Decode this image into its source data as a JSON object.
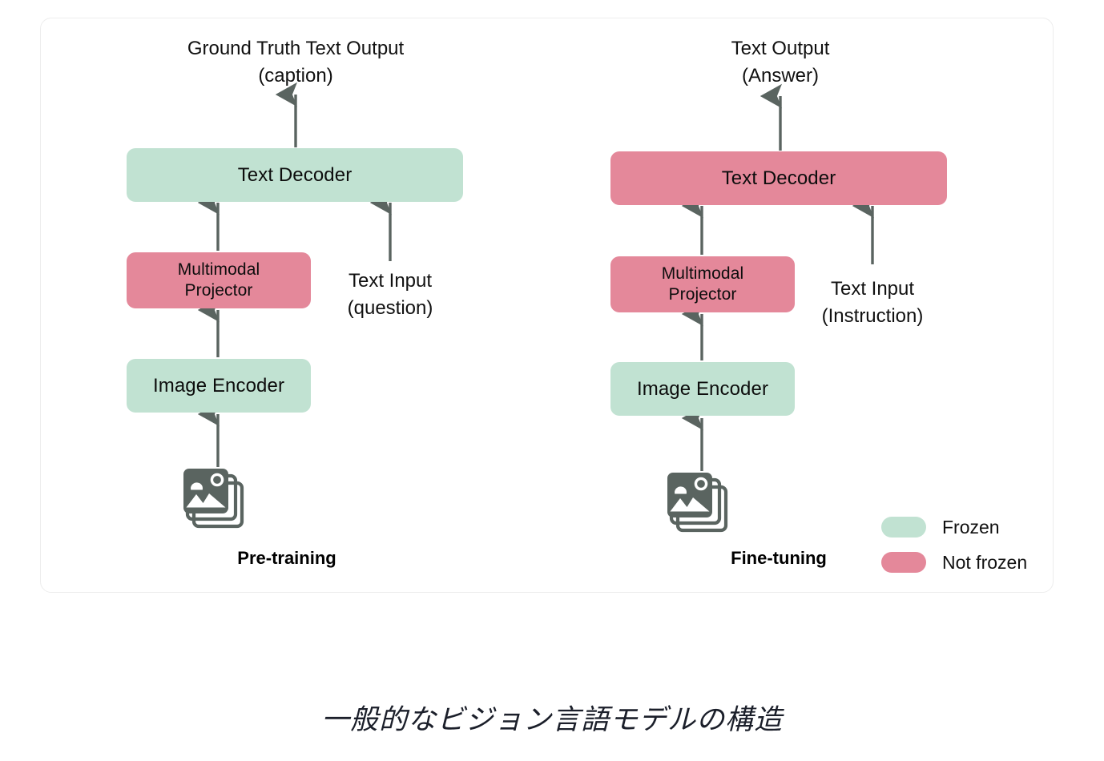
{
  "caption": "一般的なビジョン言語モデルの構造",
  "colors": {
    "frozen": "#c1e2d2",
    "not_frozen": "#e4889a",
    "arrow": "#5a6460",
    "icon": "#5a6460",
    "card_border": "#ededed",
    "background": "#ffffff",
    "text": "#111111"
  },
  "legend": {
    "items": [
      {
        "label": "Frozen",
        "color": "#c1e2d2"
      },
      {
        "label": "Not frozen",
        "color": "#e4889a"
      }
    ]
  },
  "pretraining": {
    "stage_label": "Pre-training",
    "output_label": "Ground Truth Text Output\n(caption)",
    "text_decoder": "Text Decoder",
    "multimodal_projector": "Multimodal\nProjector",
    "image_encoder": "Image Encoder",
    "text_input_label": "Text Input\n(question)",
    "image_input_icon": "image-stack-icon",
    "states": {
      "text_decoder": "Frozen",
      "multimodal_projector": "Not frozen",
      "image_encoder": "Frozen"
    }
  },
  "finetuning": {
    "stage_label": "Fine-tuning",
    "output_label": "Text Output\n(Answer)",
    "text_decoder": "Text Decoder",
    "multimodal_projector": "Multimodal\nProjector",
    "image_encoder": "Image Encoder",
    "text_input_label": "Text Input\n(Instruction)",
    "image_input_icon": "image-stack-icon",
    "states": {
      "text_decoder": "Not frozen",
      "multimodal_projector": "Not frozen",
      "image_encoder": "Frozen"
    }
  }
}
